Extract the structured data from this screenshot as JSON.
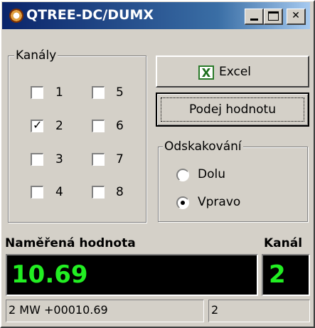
{
  "window": {
    "title": "QTREE-DC/DUMX",
    "icon": "gear-globe-icon",
    "title_gradient": [
      "#0a246a",
      "#a6caf0"
    ]
  },
  "channels": {
    "group_label": "Kanály",
    "items": [
      {
        "label": "1",
        "checked": false
      },
      {
        "label": "2",
        "checked": true
      },
      {
        "label": "3",
        "checked": false
      },
      {
        "label": "4",
        "checked": false
      },
      {
        "label": "5",
        "checked": false
      },
      {
        "label": "6",
        "checked": false
      },
      {
        "label": "7",
        "checked": false
      },
      {
        "label": "8",
        "checked": false
      }
    ]
  },
  "buttons": {
    "excel_label": "Excel",
    "excel_icon": "excel-icon",
    "request_label": "Podej hodnotu"
  },
  "jump": {
    "group_label": "Odskakování",
    "options": [
      {
        "label": "Dolu",
        "selected": false
      },
      {
        "label": "Vpravo",
        "selected": true
      }
    ]
  },
  "measurement": {
    "value_label": "Naměřená hodnota",
    "channel_label": "Kanál",
    "value": "10.69",
    "channel": "2",
    "display_color": "#22ee22"
  },
  "status": {
    "raw": "2 MW +00010.69",
    "channel": "2"
  }
}
